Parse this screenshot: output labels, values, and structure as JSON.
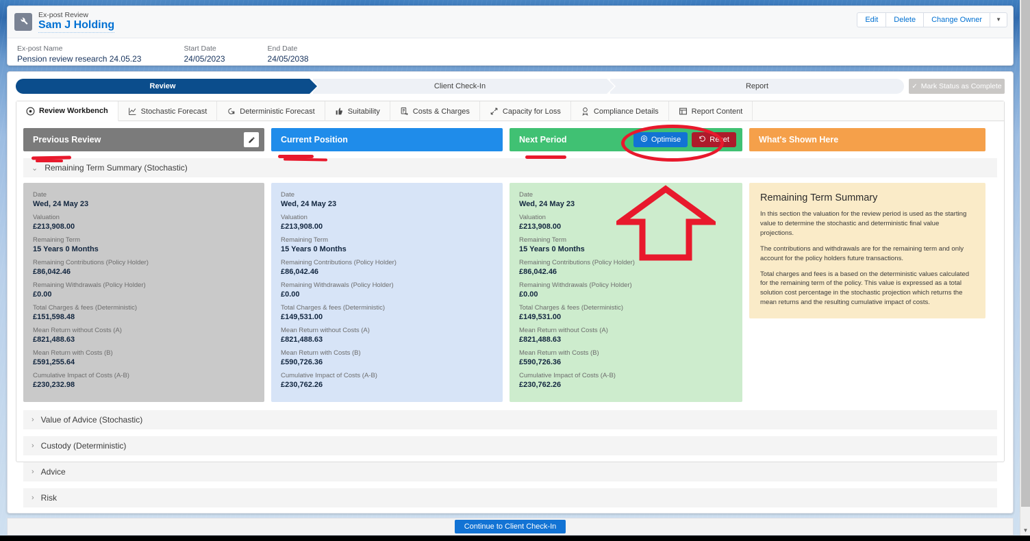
{
  "record": {
    "object_type": "Ex-post Review",
    "title": "Sam J Holding",
    "icon": "wrench-icon",
    "fields": [
      {
        "label": "Ex-post Name",
        "value": "Pension review research 24.05.23"
      },
      {
        "label": "Start Date",
        "value": "24/05/2023"
      },
      {
        "label": "End Date",
        "value": "24/05/2038"
      }
    ],
    "actions": [
      "Edit",
      "Delete",
      "Change Owner"
    ],
    "actions_caret": "▼"
  },
  "path": {
    "steps": [
      {
        "label": "Review",
        "state": "current"
      },
      {
        "label": "Client Check-In",
        "state": "incomplete"
      },
      {
        "label": "Report",
        "state": "incomplete"
      }
    ],
    "action_label": "Mark Status as Complete",
    "action_icon": "check-icon"
  },
  "tabs": [
    {
      "label": "Review Workbench",
      "icon": "eye-icon",
      "active": true
    },
    {
      "label": "Stochastic Forecast",
      "icon": "line-chart-icon",
      "active": false
    },
    {
      "label": "Deterministic Forecast",
      "icon": "arrow-spiral-icon",
      "active": false
    },
    {
      "label": "Suitability",
      "icon": "thumbs-up-icon",
      "active": false
    },
    {
      "label": "Costs & Charges",
      "icon": "document-arrow-icon",
      "active": false
    },
    {
      "label": "Capacity for Loss",
      "icon": "expand-arrows-icon",
      "active": false
    },
    {
      "label": "Compliance Details",
      "icon": "badge-icon",
      "active": false
    },
    {
      "label": "Report Content",
      "icon": "layout-icon",
      "active": false
    }
  ],
  "columns": {
    "previous": {
      "title": "Previous Review",
      "color": "#7b7b7b",
      "edit_icon": "pencil-icon"
    },
    "current": {
      "title": "Current Position",
      "color": "#1f8cea"
    },
    "next": {
      "title": "Next Period",
      "color": "#40c173",
      "optimise_label": "Optimise",
      "optimise_icon": "target-icon",
      "reset_label": "Reset",
      "reset_icon": "undo-icon"
    },
    "whats_shown": {
      "title": "What's Shown Here",
      "color": "#f5a04a"
    }
  },
  "sections": {
    "open": {
      "label": "Remaining Term Summary (Stochastic)",
      "chevron": "⌄"
    },
    "collapsed": [
      {
        "label": "Value of Advice (Stochastic)",
        "chevron": "›"
      },
      {
        "label": "Custody (Deterministic)",
        "chevron": "›"
      },
      {
        "label": "Advice",
        "chevron": "›"
      },
      {
        "label": "Risk",
        "chevron": "›"
      }
    ]
  },
  "row_labels": [
    "Date",
    "Valuation",
    "Remaining Term",
    "Remaining Contributions (Policy Holder)",
    "Remaining Withdrawals (Policy Holder)",
    "Total Charges & fees (Deterministic)",
    "Mean Return without Costs (A)",
    "Mean Return with Costs (B)",
    "Cumulative Impact of Costs (A-B)"
  ],
  "card_values": {
    "previous": [
      "Wed, 24 May 23",
      "£213,908.00",
      "15 Years 0 Months",
      "£86,042.46",
      "£0.00",
      "£151,598.48",
      "£821,488.63",
      "£591,255.64",
      "£230,232.98"
    ],
    "current": [
      "Wed, 24 May 23",
      "£213,908.00",
      "15 Years 0 Months",
      "£86,042.46",
      "£0.00",
      "£149,531.00",
      "£821,488.63",
      "£590,726.36",
      "£230,762.26"
    ],
    "next": [
      "Wed, 24 May 23",
      "£213,908.00",
      "15 Years 0 Months",
      "£86,042.46",
      "£0.00",
      "£149,531.00",
      "£821,488.63",
      "£590,726.36",
      "£230,762.26"
    ]
  },
  "info_panel": {
    "heading": "Remaining Term Summary",
    "paragraphs": [
      "In this section the valuation for the review period is used as the starting value to determine the stochastic and deterministic final value projections.",
      "The contributions and withdrawals are for the remaining term and only account for the policy holders future transactions.",
      "Total charges and fees is a based on the deterministic values calculated for the remaining term of the policy. This value is expressed as a total solution cost percentage in the stochastic projection which returns the mean returns and the resulting cumulative impact of costs."
    ]
  },
  "footer": {
    "continue_label": "Continue to Client Check-In"
  },
  "annotations": {
    "highlight_color": "#e8192c"
  }
}
